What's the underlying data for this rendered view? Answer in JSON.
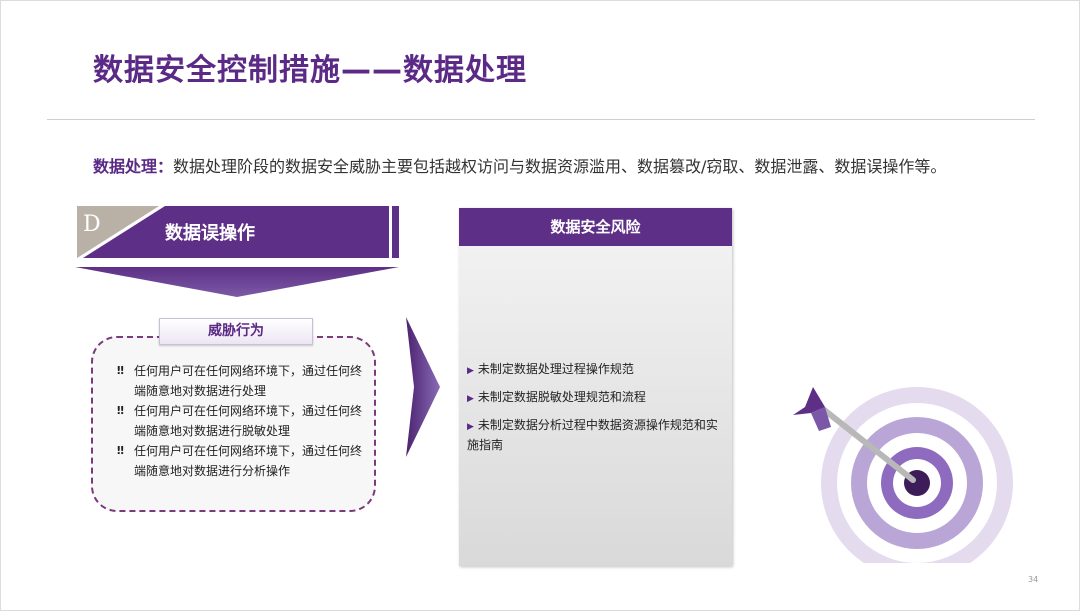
{
  "slide": {
    "title": "数据安全控制措施——数据处理",
    "intro_lead": "数据处理：",
    "intro_text": "数据处理阶段的数据安全威胁主要包括越权访问与数据资源滥用、数据篡改/窃取、数据泄露、数据误操作等。",
    "page_number": "34"
  },
  "section": {
    "letter": "D",
    "title": "数据误操作"
  },
  "threat": {
    "title": "威胁行为",
    "bullet_mark": "‼",
    "items": [
      "任何用户可在任何网络环境下，通过任何终端随意地对数据进行处理",
      "任何用户可在任何网络环境下，通过任何终端随意地对数据进行脱敏处理",
      "任何用户可在任何网络环境下，通过任何终端随意地对数据进行分析操作"
    ]
  },
  "risk": {
    "title": "数据安全风险",
    "bullet_mark": "▶",
    "items": [
      "未制定数据处理过程操作规范",
      "未制定数据脱敏处理规范和流程",
      "未制定数据分析过程中数据资源操作规范和实施指南"
    ]
  },
  "colors": {
    "brand_purple": "#5b2a86",
    "banner_grey": "#b9b1a6",
    "target_light": "#d8cde6",
    "target_mid": "#8e6bbf",
    "target_dark": "#3d1c5a"
  },
  "icons": {
    "target": "target-with-arrow-icon",
    "chevron": "chevron-right-icon",
    "down": "down-arrow-band-icon"
  }
}
